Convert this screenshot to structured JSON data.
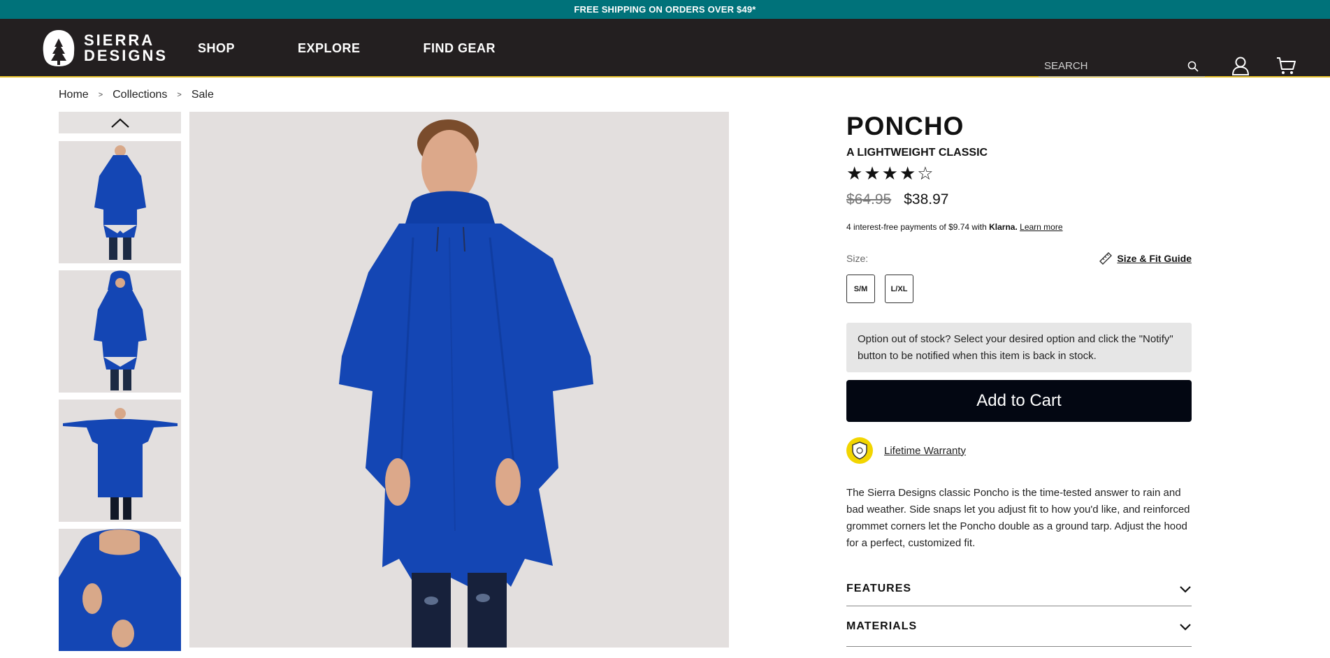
{
  "announcement": "FREE SHIPPING ON ORDERS OVER $49*",
  "brand": {
    "line1": "SIERRA",
    "line2": "DESIGNS"
  },
  "nav": {
    "items": [
      "SHOP",
      "EXPLORE",
      "FIND GEAR"
    ]
  },
  "search": {
    "placeholder": "SEARCH"
  },
  "breadcrumb": [
    "Home",
    "Collections",
    "Sale"
  ],
  "breadcrumb_separator": ">",
  "product": {
    "title": "PONCHO",
    "subtitle": "A LIGHTWEIGHT CLASSIC",
    "rating": {
      "filled": 4,
      "total": 5
    },
    "price_old": "$64.95",
    "price_new": "$38.97",
    "klarna": {
      "text": "4 interest-free payments of $9.74 with",
      "brand": "Klarna.",
      "link": "Learn more"
    },
    "size_label": "Size:",
    "size_guide": "Size & Fit Guide",
    "sizes": [
      "S/M",
      "L/XL"
    ],
    "notice": "Option out of stock? Select your desired option and click the \"Notify\" button to be notified when this item is back in stock.",
    "add_to_cart": "Add to Cart",
    "warranty": "Lifetime Warranty",
    "description": "The Sierra Designs classic Poncho is the time-tested answer to rain and bad weather. Side snaps let you adjust fit to how you'd like, and reinforced grommet corners let the Poncho double as a ground tarp. Adjust the hood for a perfect, customized fit.",
    "accordions": [
      "FEATURES",
      "MATERIALS"
    ]
  },
  "colors": {
    "announce_bg": "#00727a",
    "nav_bg": "#231f20",
    "accent_line": "#e6c22e",
    "poncho_blue": "#1446b4",
    "button_bg": "#030712",
    "warranty_yellow": "#f2d500"
  }
}
